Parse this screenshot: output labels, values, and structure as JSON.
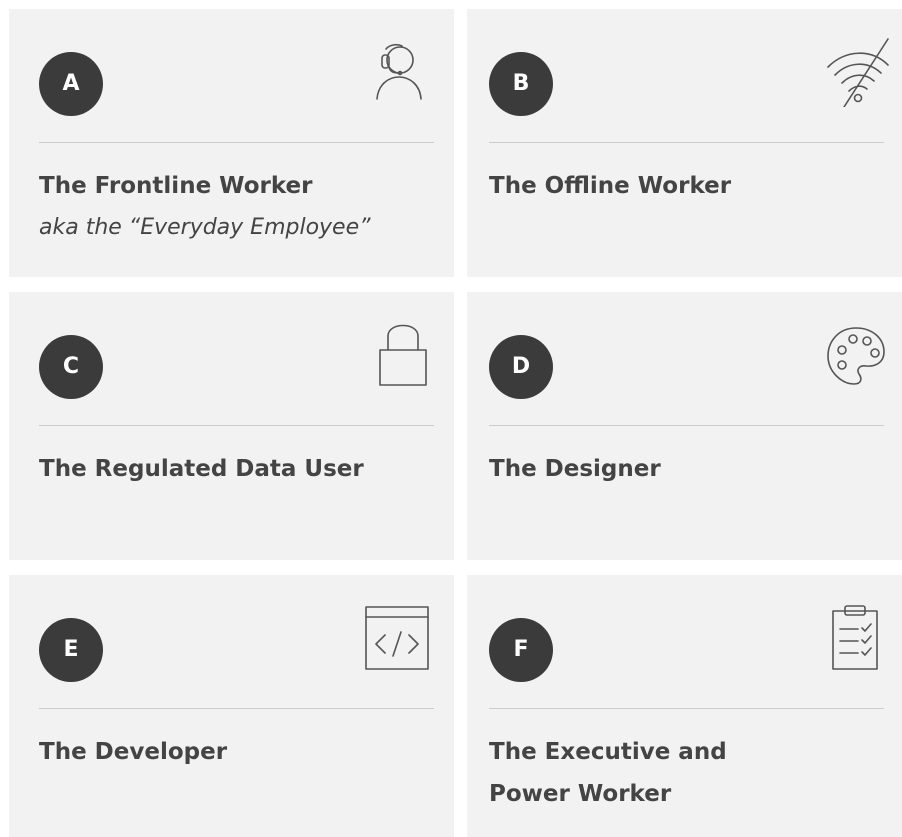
{
  "cards": [
    {
      "badge": "A",
      "title": "The Frontline Worker",
      "subtitle": "aka the “Everyday Employee”",
      "icon": "headset-user-icon"
    },
    {
      "badge": "B",
      "title": "The Offline Worker",
      "icon": "wifi-off-icon"
    },
    {
      "badge": "C",
      "title": "The Regulated Data User",
      "icon": "lock-icon"
    },
    {
      "badge": "D",
      "title": "The Designer",
      "icon": "palette-icon"
    },
    {
      "badge": "E",
      "title": "The Developer",
      "icon": "code-window-icon"
    },
    {
      "badge": "F",
      "title": "The Executive and Power Worker",
      "icon": "clipboard-checklist-icon"
    }
  ],
  "colors": {
    "card_background": "#f2f2f2",
    "badge_background": "#3b3b3b",
    "text": "#444444",
    "divider": "#cccccc",
    "icon_stroke": "#555555"
  }
}
